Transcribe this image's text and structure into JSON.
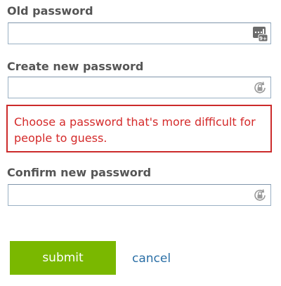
{
  "old_password": {
    "label": "Old password",
    "value": "",
    "icon": "keyboard-badge-icon",
    "icon_badge": "9+"
  },
  "new_password": {
    "label": "Create new password",
    "value": "",
    "icon": "password-reveal-icon"
  },
  "error": {
    "message": "Choose a password that's more difficult for people to guess.",
    "color": "#d42a2a"
  },
  "confirm_password": {
    "label": "Confirm new password",
    "value": "",
    "icon": "password-reveal-icon"
  },
  "actions": {
    "submit_label": "submit",
    "cancel_label": "cancel",
    "submit_color": "#7ab800",
    "link_color": "#2b6fa6"
  }
}
